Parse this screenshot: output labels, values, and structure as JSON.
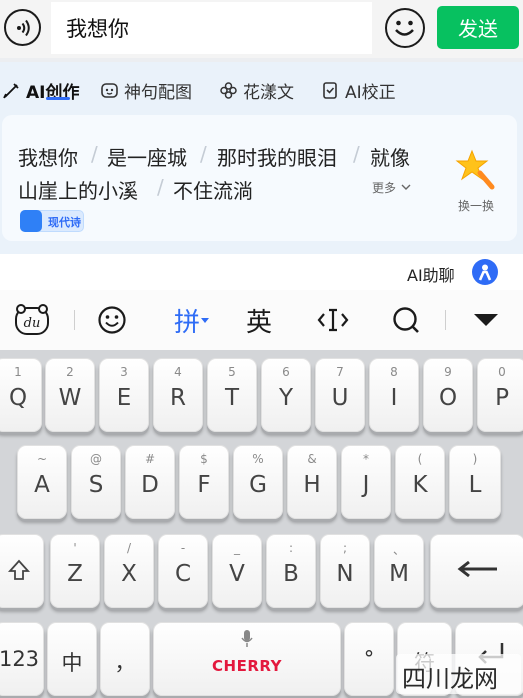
{
  "chat_bar": {
    "message_text": "我想你",
    "send_label": "发送"
  },
  "ai_tabs": [
    {
      "label": "AI创作",
      "icon": "pen-icon",
      "active": true
    },
    {
      "label": "神句配图",
      "icon": "sticker-icon",
      "active": false
    },
    {
      "label": "花漾文",
      "icon": "flower-icon",
      "active": false
    },
    {
      "label": "AI校正",
      "icon": "check-doc-icon",
      "active": false
    }
  ],
  "suggestions": {
    "chips": [
      "我想你",
      "是一座城",
      "那时我的眼泪",
      "就像",
      "山崖上的小溪",
      "不住流淌"
    ],
    "more_label": "更多",
    "swap_label": "换一换",
    "style_label": "现代诗"
  },
  "ai_chat": {
    "label": "AI助聊"
  },
  "toolbar": {
    "pinyin_label": "拼",
    "english_label": "英",
    "logo_text": "du"
  },
  "keyboard": {
    "row1": [
      {
        "sub": "1",
        "main": "Q"
      },
      {
        "sub": "2",
        "main": "W"
      },
      {
        "sub": "3",
        "main": "E"
      },
      {
        "sub": "4",
        "main": "R"
      },
      {
        "sub": "5",
        "main": "T"
      },
      {
        "sub": "6",
        "main": "Y"
      },
      {
        "sub": "7",
        "main": "U"
      },
      {
        "sub": "8",
        "main": "I"
      },
      {
        "sub": "9",
        "main": "O"
      },
      {
        "sub": "0",
        "main": "P"
      }
    ],
    "row2": [
      {
        "sub": "~",
        "main": "A"
      },
      {
        "sub": "@",
        "main": "S"
      },
      {
        "sub": "#",
        "main": "D"
      },
      {
        "sub": "$",
        "main": "F"
      },
      {
        "sub": "%",
        "main": "G"
      },
      {
        "sub": "&",
        "main": "H"
      },
      {
        "sub": "*",
        "main": "J"
      },
      {
        "sub": "(",
        "main": "K"
      },
      {
        "sub": ")",
        "main": "L"
      }
    ],
    "row3": [
      {
        "sub": "'",
        "main": "Z"
      },
      {
        "sub": "/",
        "main": "X"
      },
      {
        "sub": "-",
        "main": "C"
      },
      {
        "sub": "_",
        "main": "V"
      },
      {
        "sub": ":",
        "main": "B"
      },
      {
        "sub": ";",
        "main": "N"
      },
      {
        "sub": "、",
        "main": "M"
      }
    ],
    "num_label": "123",
    "cn_label": "中",
    "comma_label": "，",
    "space_brand": "CHERRY",
    "period_label": "°",
    "symbol_label": "符"
  },
  "watermark": "四川龙网",
  "colors": {
    "send_green": "#07c160",
    "accent_blue": "#2f6cf6",
    "cherry_red": "#e3183d"
  }
}
